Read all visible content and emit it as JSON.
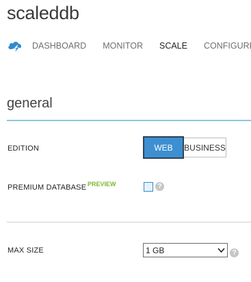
{
  "app": {
    "title": "scaleddb"
  },
  "nav": {
    "icon": "cloud-database-icon",
    "tabs": [
      {
        "label": "DASHBOARD",
        "active": false
      },
      {
        "label": "MONITOR",
        "active": false
      },
      {
        "label": "SCALE",
        "active": true
      },
      {
        "label": "CONFIGURE",
        "active": false
      }
    ]
  },
  "section": {
    "title": "general"
  },
  "edition": {
    "label": "EDITION",
    "options": [
      "WEB",
      "BUSINESS"
    ],
    "selected": "WEB",
    "accent_color": "#3d8fd2"
  },
  "premium": {
    "label": "PREMIUM DATABASE",
    "badge": "PREVIEW",
    "badge_color": "#7cb82f",
    "checked": false,
    "help_icon": "question-icon",
    "help_glyph": "?"
  },
  "max_size": {
    "label": "MAX SIZE",
    "value": "1 GB",
    "help_icon": "question-icon",
    "help_glyph": "?"
  }
}
